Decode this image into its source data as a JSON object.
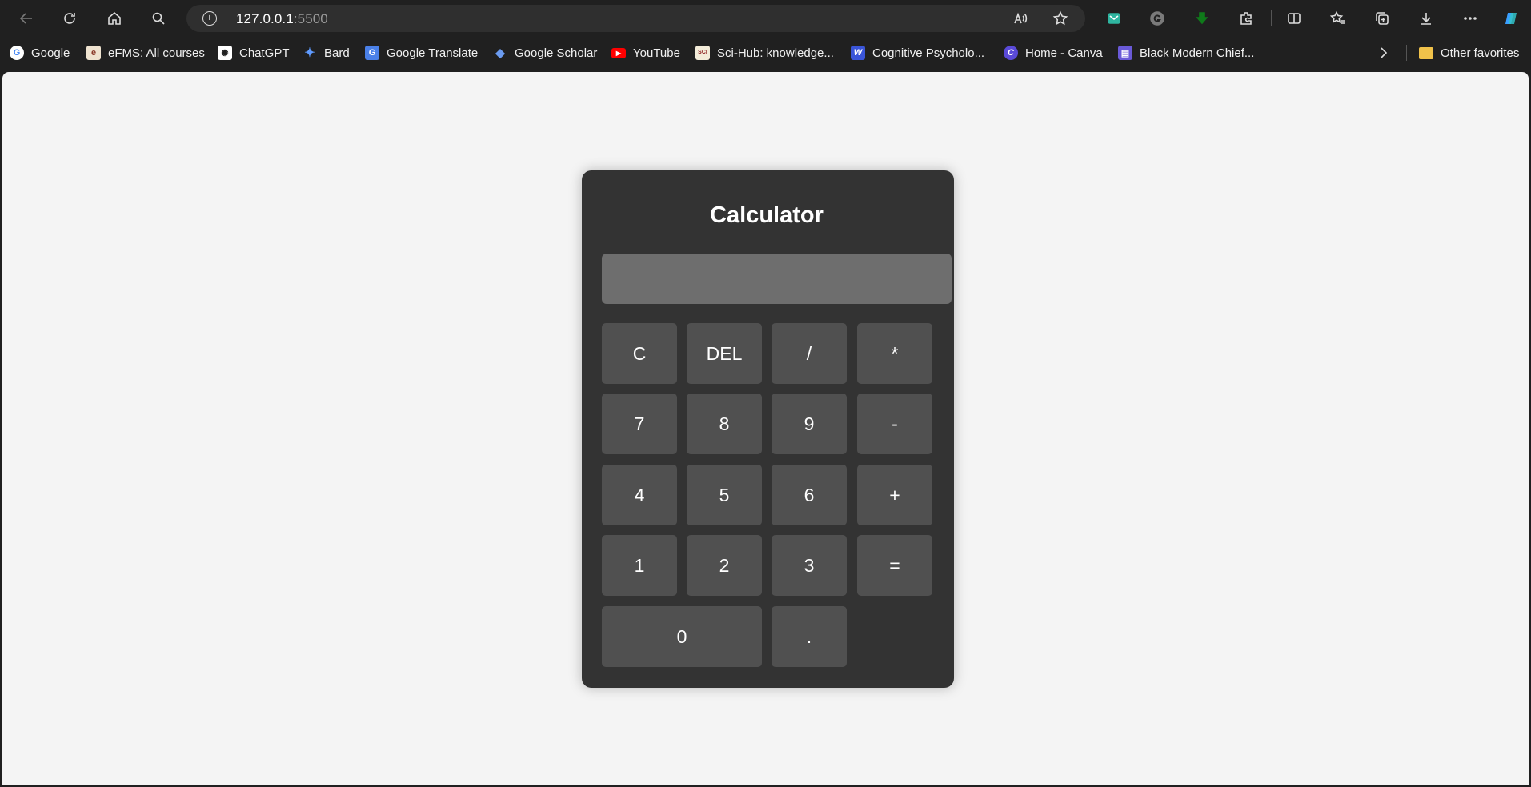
{
  "browser": {
    "url_host": "127.0.0.1",
    "url_port": ":5500"
  },
  "bookmarks": [
    {
      "label": "Google",
      "icon": "google-icon"
    },
    {
      "label": "eFMS: All courses",
      "icon": "efms-icon"
    },
    {
      "label": "ChatGPT",
      "icon": "chatgpt-icon"
    },
    {
      "label": "Bard",
      "icon": "bard-icon"
    },
    {
      "label": "Google Translate",
      "icon": "translate-icon"
    },
    {
      "label": "Google Scholar",
      "icon": "scholar-icon"
    },
    {
      "label": "YouTube",
      "icon": "youtube-icon"
    },
    {
      "label": "Sci-Hub: knowledge...",
      "icon": "scihub-icon"
    },
    {
      "label": "Cognitive Psycholo...",
      "icon": "word-icon"
    },
    {
      "label": "Home - Canva",
      "icon": "canva-icon"
    },
    {
      "label": "Black Modern Chief...",
      "icon": "doc-icon"
    },
    {
      "label": "Other favorites",
      "icon": "folder-icon"
    }
  ],
  "calculator": {
    "title": "Calculator",
    "display_value": "",
    "keys": [
      "C",
      "DEL",
      "/",
      "*",
      "7",
      "8",
      "9",
      "-",
      "4",
      "5",
      "6",
      "+",
      "1",
      "2",
      "3",
      "=",
      "0",
      "."
    ]
  }
}
